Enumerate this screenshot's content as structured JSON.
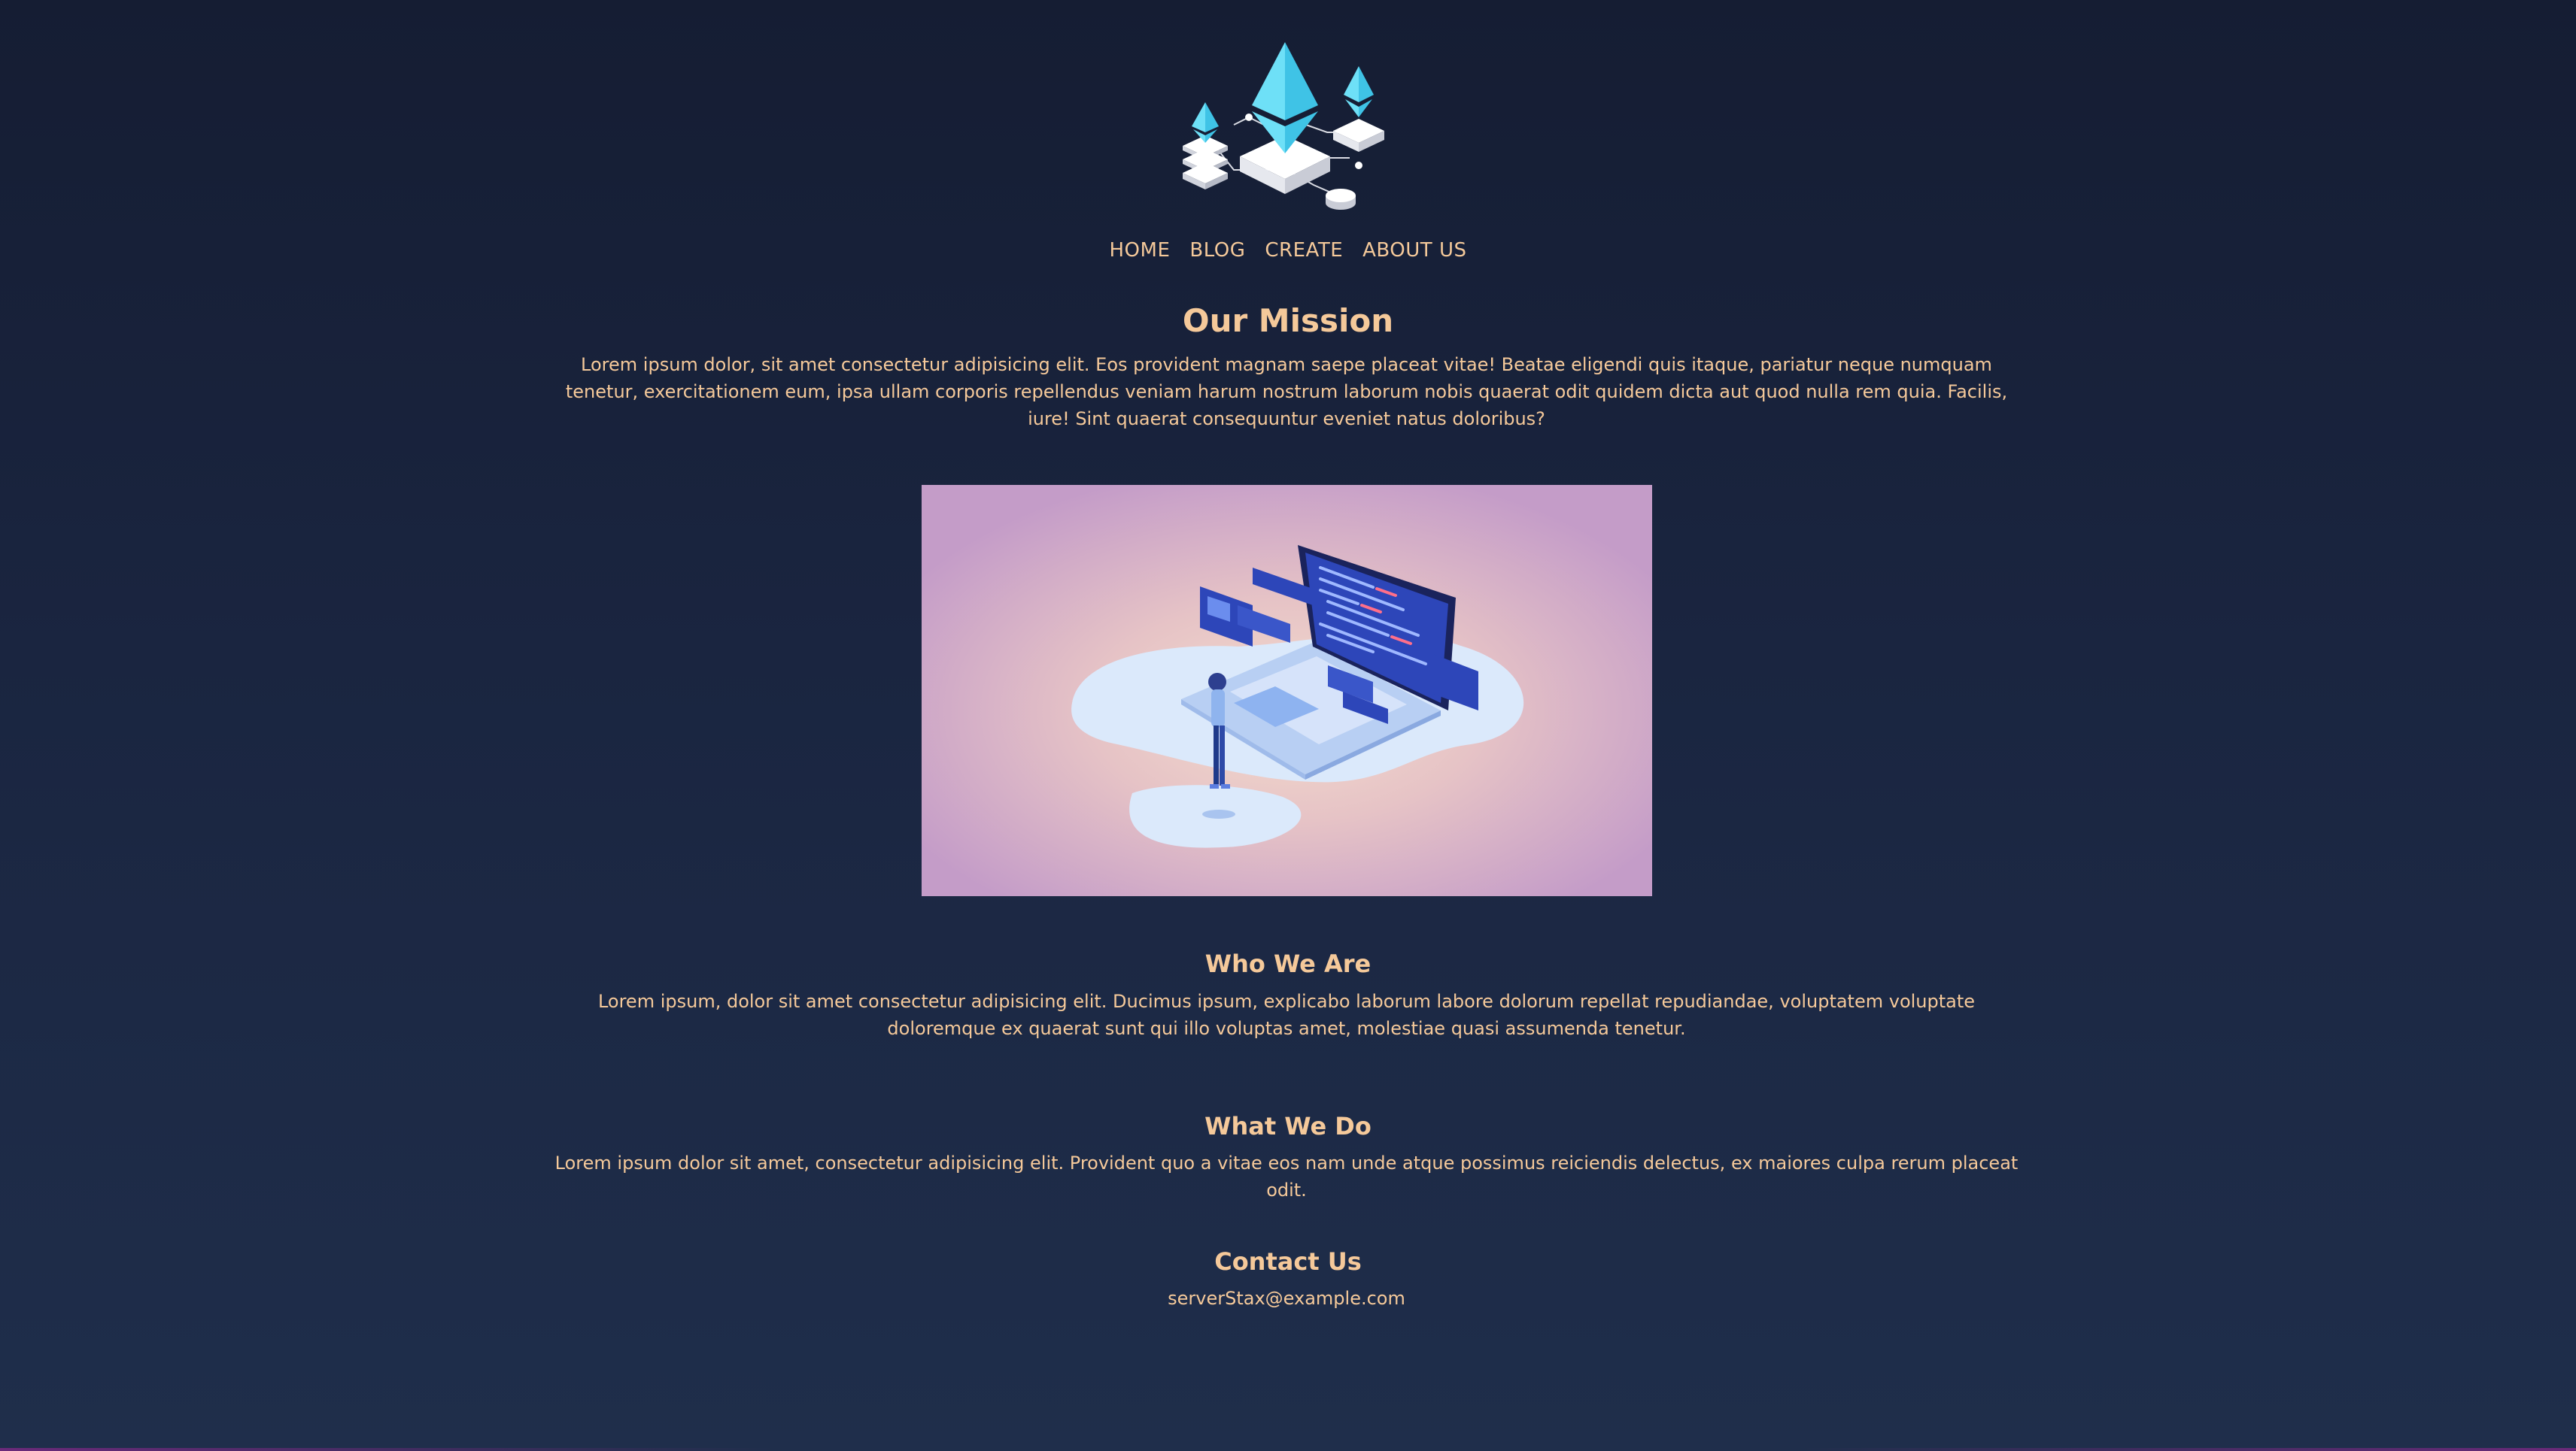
{
  "nav": {
    "items": [
      {
        "label": "HOME"
      },
      {
        "label": "BLOG"
      },
      {
        "label": "CREATE"
      },
      {
        "label": "ABOUT US"
      }
    ]
  },
  "mission": {
    "title": "Our Mission",
    "text": "Lorem ipsum dolor, sit amet consectetur adipisicing elit. Eos provident magnam saepe placeat vitae! Beatae eligendi quis itaque, pariatur neque numquam tenetur, exercitationem eum, ipsa ullam corporis repellendus veniam harum nostrum laborum nobis quaerat odit quidem dicta aut quod nulla rem quia. Facilis, iure! Sint quaerat consequuntur eveniet natus doloribus?"
  },
  "who": {
    "title": "Who We Are",
    "text": "Lorem ipsum, dolor sit amet consectetur adipisicing elit. Ducimus ipsum, explicabo laborum labore dolorum repellat repudiandae, voluptatem voluptate doloremque ex quaerat sunt qui illo voluptas amet, molestiae quasi assumenda tenetur."
  },
  "what": {
    "title": "What We Do",
    "text": "Lorem ipsum dolor sit amet, consectetur adipisicing elit. Provident quo a vitae eos nam unde atque possimus reiciendis delectus, ex maiores culpa rerum placeat odit."
  },
  "contact": {
    "title": "Contact Us",
    "email": "serverStax@example.com"
  },
  "colors": {
    "text": "#f5c99a",
    "background": "#1a2540",
    "accent": "#5fd3f3",
    "hero_bg": "#c9a2c9"
  }
}
